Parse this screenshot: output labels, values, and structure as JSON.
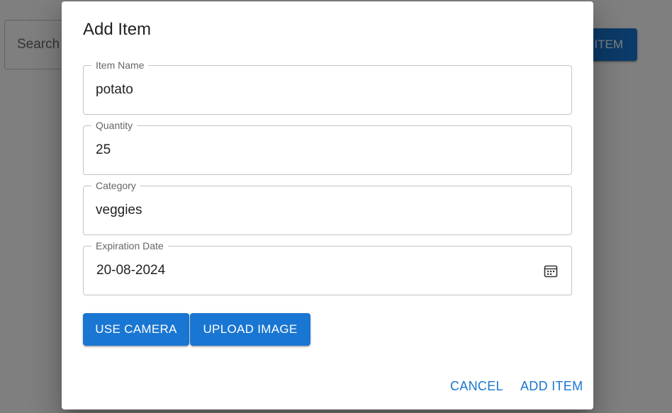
{
  "background": {
    "search_placeholder": "Search",
    "add_item_button": "ITEM"
  },
  "dialog": {
    "title": "Add Item",
    "fields": [
      {
        "label": "Item Name",
        "value": "potato"
      },
      {
        "label": "Quantity",
        "value": "25"
      },
      {
        "label": "Category",
        "value": "veggies"
      },
      {
        "label": "Expiration Date",
        "value": "20-08-2024",
        "icon": "calendar-icon"
      }
    ],
    "buttons": {
      "use_camera": "USE CAMERA",
      "upload_image": "UPLOAD IMAGE",
      "cancel": "CANCEL",
      "add_item": "ADD ITEM"
    }
  },
  "colors": {
    "primary": "#1976d2",
    "backdrop": "rgba(0,0,0,0.5)",
    "border": "#c4c4c4"
  }
}
